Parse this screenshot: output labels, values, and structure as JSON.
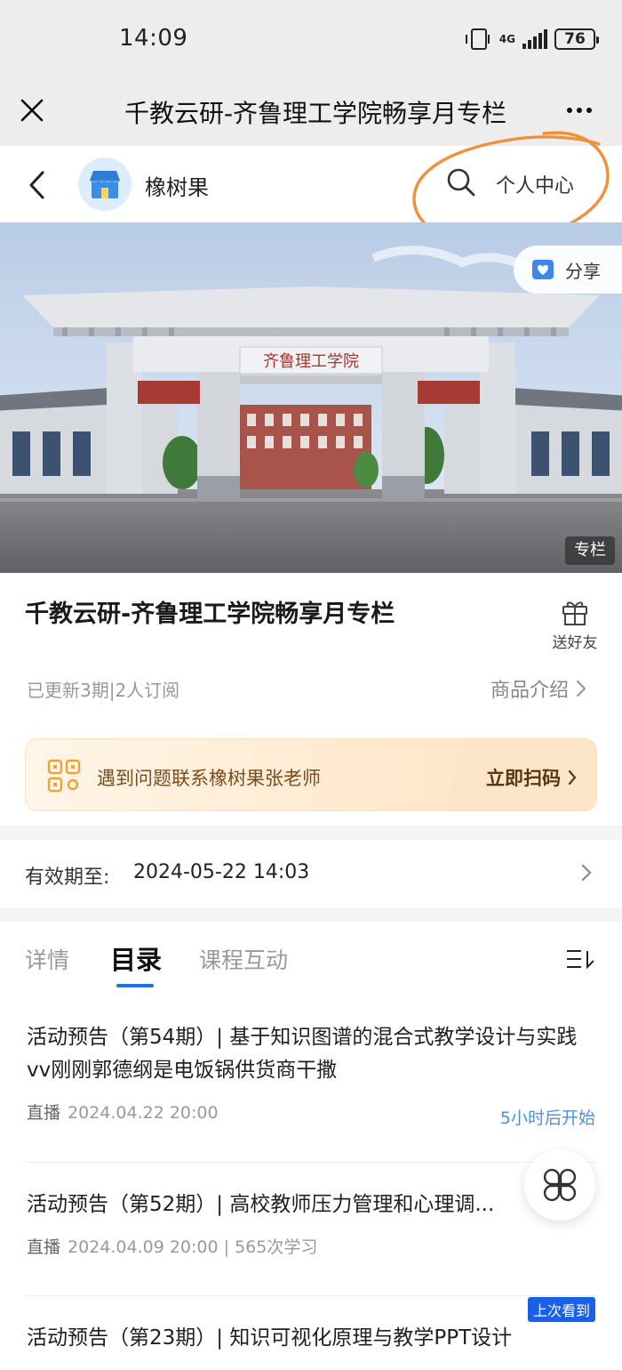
{
  "status_bar": {
    "time": "14:09",
    "network": "4G",
    "battery": "76"
  },
  "title_bar": {
    "title": "千教云研-齐鲁理工学院畅享月专栏"
  },
  "shop": {
    "name": "橡树果",
    "personal_center": "个人中心"
  },
  "hero": {
    "gate_sign": "齐鲁理工学院",
    "share_label": "分享",
    "tag": "专栏"
  },
  "course": {
    "title": "千教云研-齐鲁理工学院畅享月专栏",
    "gift_label": "送好友",
    "meta": "已更新3期|2人订阅",
    "product_intro": "商品介绍"
  },
  "banner": {
    "text": "遇到问题联系橡树果张老师",
    "button": "立即扫码"
  },
  "validity": {
    "label": "有效期至:",
    "date": "2024-05-22 14:03"
  },
  "tabs": [
    {
      "label": "详情"
    },
    {
      "label": "目录"
    },
    {
      "label": "课程互动"
    }
  ],
  "active_tab": "目录",
  "items": [
    {
      "title": "活动预告（第54期）| 基于知识图谱的混合式教学设计与实践vv刚刚郭德纲是电饭锅供货商干撒",
      "type": "直播",
      "meta": "2024.04.22 20:00",
      "status": "5小时后开始"
    },
    {
      "title": "活动预告（第52期）| 高校教师压力管理和心理调...",
      "type": "直播",
      "meta": "2024.04.09 20:00 | 565次学习",
      "status": ""
    },
    {
      "title": "活动预告（第23期）| 知识可视化原理与教学PPT设计",
      "type": "",
      "meta": "",
      "status": ""
    }
  ],
  "last_seen_badge": "上次看到",
  "colors": {
    "accent_blue": "#1a73e8",
    "status_blue": "#4a90e2",
    "annotation_orange": "#f0913a",
    "banner_text": "#7a4d1a"
  }
}
